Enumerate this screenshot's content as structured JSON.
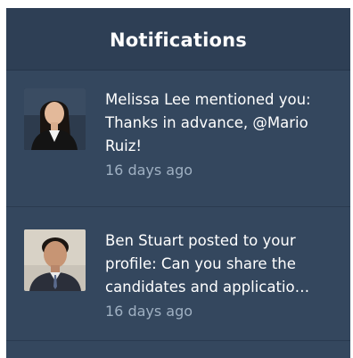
{
  "header": {
    "title": "Notifications"
  },
  "notifications": [
    {
      "avatar_icon": "user-avatar-photo",
      "message": "Melissa Lee mentioned you: Thanks in advance, @Mario Ruiz!",
      "time": "16 days ago"
    },
    {
      "avatar_icon": "user-avatar-photo",
      "message": "Ben Stuart posted to your profile: Can you share the candidates and applicatio…",
      "time": "16 days ago"
    }
  ],
  "colors": {
    "panel": "#34475e",
    "header": "#2e3f55",
    "text": "#ffffff",
    "muted": "#9fb0c2"
  }
}
